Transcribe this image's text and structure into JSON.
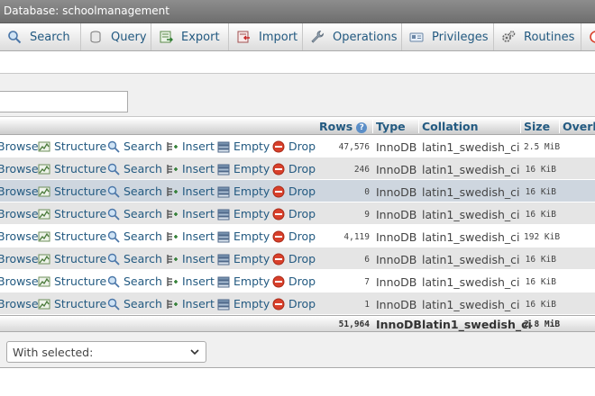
{
  "breadcrumb": {
    "label": "Database: schoolmanagement"
  },
  "tabs": [
    {
      "id": "search",
      "label": "Search",
      "icon": "search-icon"
    },
    {
      "id": "query",
      "label": "Query",
      "icon": "query-icon"
    },
    {
      "id": "export",
      "label": "Export",
      "icon": "export-icon"
    },
    {
      "id": "import",
      "label": "Import",
      "icon": "import-icon"
    },
    {
      "id": "operations",
      "label": "Operations",
      "icon": "wrench-icon"
    },
    {
      "id": "privileges",
      "label": "Privileges",
      "icon": "privileges-icon"
    },
    {
      "id": "routines",
      "label": "Routines",
      "icon": "routines-icon"
    }
  ],
  "filter": {
    "value": ""
  },
  "table": {
    "headers": {
      "rows": "Rows",
      "type": "Type",
      "collation": "Collation",
      "size": "Size",
      "overhead": "Overh"
    },
    "actions": {
      "browse": "Browse",
      "structure": "Structure",
      "search": "Search",
      "insert": "Insert",
      "empty": "Empty",
      "drop": "Drop"
    },
    "rows": [
      {
        "rows": "47,576",
        "type": "InnoDB",
        "collation": "latin1_swedish_ci",
        "size": "2.5",
        "unit": "MiB"
      },
      {
        "rows": "246",
        "type": "InnoDB",
        "collation": "latin1_swedish_ci",
        "size": "16",
        "unit": "KiB"
      },
      {
        "rows": "0",
        "type": "InnoDB",
        "collation": "latin1_swedish_ci",
        "size": "16",
        "unit": "KiB"
      },
      {
        "rows": "9",
        "type": "InnoDB",
        "collation": "latin1_swedish_ci",
        "size": "16",
        "unit": "KiB"
      },
      {
        "rows": "4,119",
        "type": "InnoDB",
        "collation": "latin1_swedish_ci",
        "size": "192",
        "unit": "KiB"
      },
      {
        "rows": "6",
        "type": "InnoDB",
        "collation": "latin1_swedish_ci",
        "size": "16",
        "unit": "KiB"
      },
      {
        "rows": "7",
        "type": "InnoDB",
        "collation": "latin1_swedish_ci",
        "size": "16",
        "unit": "KiB"
      },
      {
        "rows": "1",
        "type": "InnoDB",
        "collation": "latin1_swedish_ci",
        "size": "16",
        "unit": "KiB"
      }
    ],
    "total": {
      "rows": "51,964",
      "type": "InnoDB",
      "collation": "latin1_swedish_ci",
      "size": "2.8",
      "unit": "MiB"
    }
  },
  "footer": {
    "with_selected": "With selected:"
  },
  "colors": {
    "link": "#235a81",
    "title_bar": "#7a7a7a",
    "row_even": "#e5e5e5",
    "row_highlight": "#ced6df",
    "drop_red": "#d9402b"
  }
}
